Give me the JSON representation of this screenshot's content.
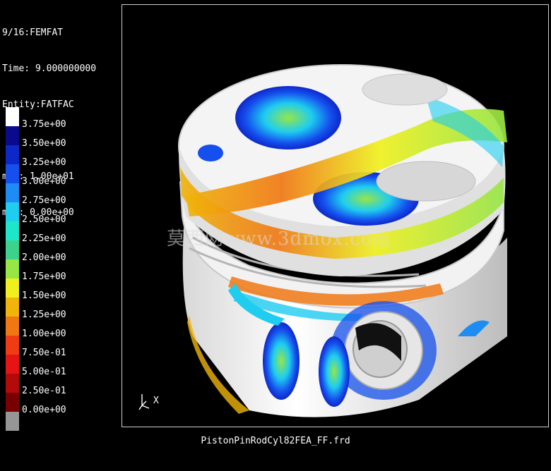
{
  "header": {
    "step": "9/16:FEMFAT",
    "time": "Time: 9.000000000",
    "entity": "Entity:FATFAC",
    "max": "max: 1.00e+01",
    "min": "min: 0.00e+00"
  },
  "legend": {
    "colors": [
      "#ffffff",
      "#0a0a8c",
      "#0d28c8",
      "#1550ee",
      "#1e8cf5",
      "#1ecdf0",
      "#1ee6c8",
      "#3cd28c",
      "#96e646",
      "#f0f01e",
      "#f0b40a",
      "#f07814",
      "#f03c14",
      "#e61414",
      "#b40a0a",
      "#780000",
      "#969696"
    ],
    "labels": [
      "3.75e+00",
      "3.50e+00",
      "3.25e+00",
      "3.00e+00",
      "2.75e+00",
      "2.50e+00",
      "2.25e+00",
      "2.00e+00",
      "1.75e+00",
      "1.50e+00",
      "1.25e+00",
      "1.00e+00",
      "7.50e-01",
      "5.00e-01",
      "2.50e-01",
      "0.00e+00"
    ]
  },
  "viewport": {
    "axis_label": "X",
    "watermark": "莫西网www.3dmox.com"
  },
  "footer": {
    "filename": "PistonPinRodCyl82FEA_FF.frd"
  }
}
